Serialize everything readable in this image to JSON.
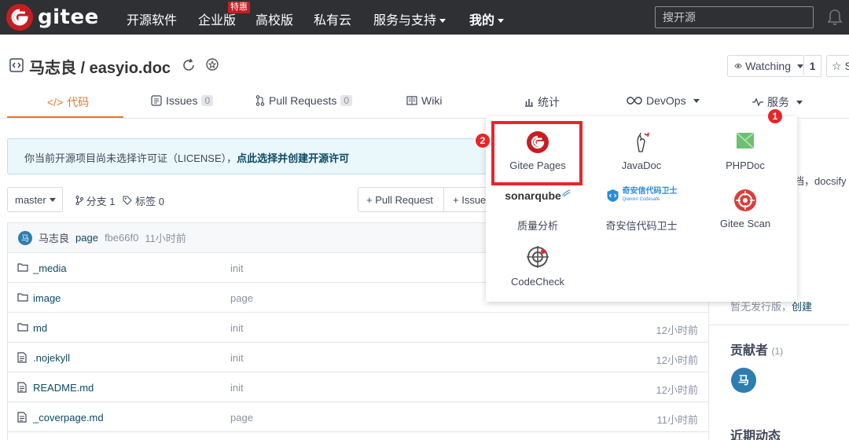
{
  "navbar": {
    "logo_text": "gitee",
    "items": [
      {
        "label": "开源软件"
      },
      {
        "label": "企业版"
      },
      {
        "label": "高校版"
      },
      {
        "label": "私有云"
      },
      {
        "label": "服务与支持"
      },
      {
        "label": "我的"
      }
    ],
    "enterprise_badge": "特惠",
    "search_placeholder": "搜开源"
  },
  "repo": {
    "title": "马志良 / easyio.doc",
    "watch_label": "Watching",
    "watch_count": "1",
    "star_label": "S"
  },
  "tabs": [
    {
      "label": "代码"
    },
    {
      "label": "Issues",
      "count": "0"
    },
    {
      "label": "Pull Requests",
      "count": "0"
    },
    {
      "label": "Wiki"
    },
    {
      "label": "统计"
    },
    {
      "label": "DevOps"
    },
    {
      "label": "服务"
    }
  ],
  "notice": {
    "text": "你当前开源项目尚未选择许可证（LICENSE），",
    "link": "点此选择并创建开源许可"
  },
  "branch": {
    "current": "master",
    "branches": "分支 1",
    "tags": "标签 0",
    "pr_button": "+ Pull Request",
    "issue_button": "+ Issue"
  },
  "commit": {
    "avatar_letter": "马",
    "author": "马志良",
    "message": "page",
    "hash": "fbe66f0",
    "time": "11小时前"
  },
  "files": [
    {
      "type": "folder",
      "name": "_media",
      "commit": "init",
      "time": ""
    },
    {
      "type": "folder",
      "name": "image",
      "commit": "page",
      "time": ""
    },
    {
      "type": "folder",
      "name": "md",
      "commit": "init",
      "time": "12小时前"
    },
    {
      "type": "file",
      "name": ".nojekyll",
      "commit": "init",
      "time": "12小时前"
    },
    {
      "type": "file",
      "name": "README.md",
      "commit": "init",
      "time": "12小时前"
    },
    {
      "type": "file",
      "name": "_coverpage.md",
      "commit": "page",
      "time": "11小时前"
    }
  ],
  "sidebar": {
    "desc_fragment": "档，docsify",
    "release_text": "暂无发行版，",
    "release_link": "创建",
    "contributors_title": "贡献者",
    "contributors_count": "(1)",
    "contributor_letter": "马",
    "activity_title": "近期动态"
  },
  "dropdown": {
    "items": [
      {
        "label": "Gitee Pages",
        "icon": "gitee-pages-icon"
      },
      {
        "label": "JavaDoc",
        "icon": "javadoc-icon"
      },
      {
        "label": "PHPDoc",
        "icon": "phpdoc-icon"
      },
      {
        "label": "质量分析",
        "icon": "sonarqube-icon",
        "logo_text": "sonarqube"
      },
      {
        "label": "奇安信代码卫士",
        "icon": "qianxin-icon",
        "logo_text": "奇安信代码卫士",
        "logo_subtext": "Qianxin Codesafe"
      },
      {
        "label": "Gitee Scan",
        "icon": "gitee-scan-icon"
      },
      {
        "label": "CodeCheck",
        "icon": "codecheck-icon"
      }
    ]
  },
  "annotations": {
    "badge1": "1",
    "badge2": "2"
  },
  "colors": {
    "navbar_bg": "#2e3034",
    "brand_red": "#c71d23",
    "active_tab": "#e6772d",
    "link": "#0b4a63",
    "annotation_red": "#e8262a"
  }
}
